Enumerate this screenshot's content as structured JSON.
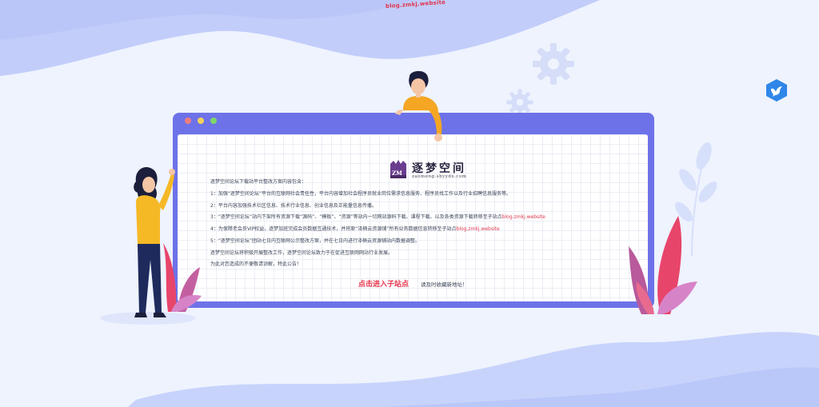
{
  "header": {
    "domain": "blog.zmkj.website"
  },
  "brand": {
    "badge": "ZM",
    "title": "逐梦空间",
    "domain": "zaomeng.sbyydx.com"
  },
  "notice": {
    "intro": "逐梦空间论坛下载站平台整改方案内容包含：",
    "item1": "1：加强“逐梦空间论坛”平台的互联网社会责任性，平台内容增加社会程序员就业岗位需求信息服务、程序员找工作以及行业招聘信息服务等。",
    "item2": "2：平台内容加强技术社区信息、技术行业信息、创业信息及正能量信息传播。",
    "item3_text": "3：“逐梦空间论坛”站内下架所有资源下载“源码”、“模板”、“资源”等站内一切网站源码下载、课程下载、以及各类资源下载转移至子站点",
    "item3_link": "blog.zmkj.website",
    "item4_text": "4：为保障老会员VIP权益，逐梦加班完成会员数据互通技术，并将原“泽楠云资源铺”所有业务数据信息转移至子站点",
    "item4_link": "blog.zmkj.website",
    "item5": "5：“逐梦空间论坛”团站七日内互联网公示整改方案，并在七日内进行泽楠云资源铺站内数据调整。",
    "closing1": "逐梦空间论坛将积极开展整改工作，逐梦空间论坛致力于在促进互联网网站行业发展。",
    "closing2": "为此对您造成的不便敬请谅解，特此公告！"
  },
  "cta": {
    "link_label": "点击进入子站点",
    "hint": "请及时收藏新地址！"
  },
  "icons": {
    "share": "share-bird-icon",
    "gear": "gear-icon"
  },
  "colors": {
    "window": "#6d72e8",
    "accent_red": "#e0344c",
    "background": "#eef3fe",
    "wave": "#c7d3fb"
  }
}
